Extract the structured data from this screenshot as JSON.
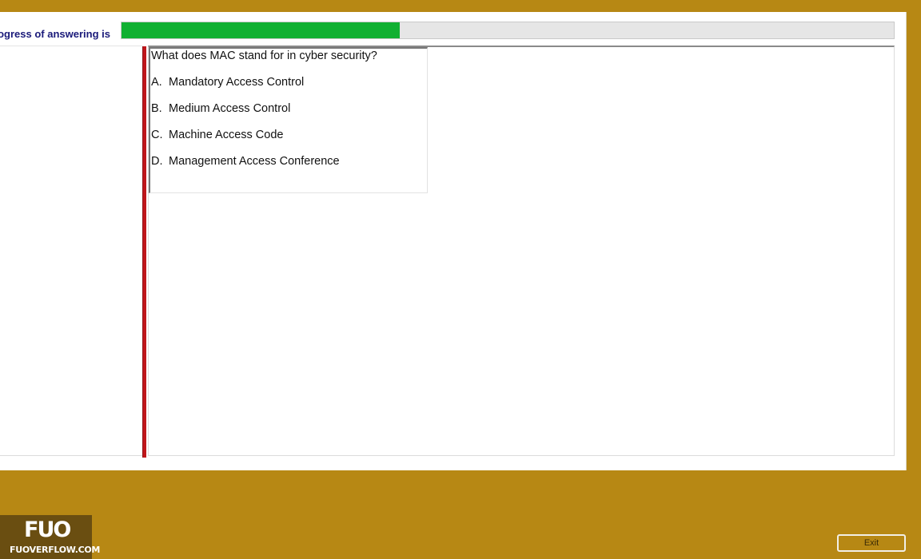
{
  "progress": {
    "label": "Progress of answering is",
    "fraction": 0.36
  },
  "question": {
    "text": "What does MAC stand for in cyber security?",
    "options": [
      {
        "letter": "A.",
        "text": "Mandatory Access Control"
      },
      {
        "letter": "B.",
        "text": "Medium Access Control"
      },
      {
        "letter": "C.",
        "text": "Machine Access Code"
      },
      {
        "letter": "D.",
        "text": "Management Access Conference"
      }
    ]
  },
  "logo": {
    "mark": "FUO",
    "url": "FUOVERFLOW.COM"
  },
  "footer": {
    "exit_label": "Exit"
  },
  "colors": {
    "background": "#b78814",
    "progress_fill": "#11b032",
    "accent_bar": "#c0161b",
    "label_text": "#1a1a7a"
  }
}
